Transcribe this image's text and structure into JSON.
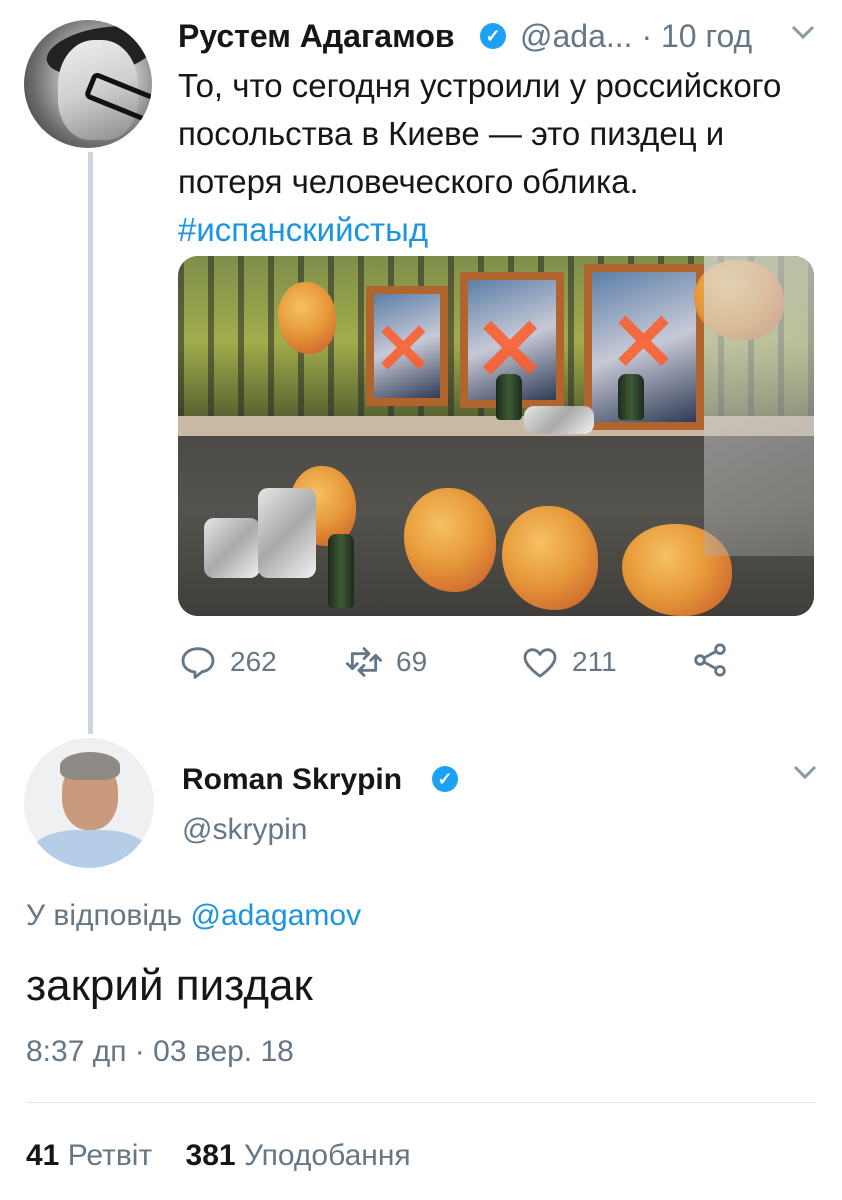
{
  "parent_tweet": {
    "author_name": "Рустем Адагамов",
    "handle_and_time": "@ada... · 10 год",
    "text": "То, что сегодня устроили у российского посольства в Киеве — это пиздец и потеря человеческого облика.",
    "hashtag": "#испанскийстыд",
    "reply_count": "262",
    "retweet_count": "69",
    "like_count": "211"
  },
  "reply_tweet": {
    "author_name": "Roman Skrypin",
    "handle": "@skrypin",
    "replying_prefix": "У відповідь",
    "replying_to": "@adagamov",
    "text": "закрий пиздак",
    "timestamp": "8:37 дп · 03 вер. 18",
    "retweets_count": "41",
    "retweets_label": "Ретвіт",
    "likes_count": "381",
    "likes_label": "Уподобання"
  },
  "icons": {
    "verified": "verified-badge-icon",
    "more": "chevron-down-icon",
    "reply": "reply-icon",
    "retweet": "retweet-icon",
    "like": "heart-icon",
    "share": "share-icon"
  },
  "colors": {
    "accent": "#1b95e0",
    "verified": "#1da1f2",
    "secondary_text": "#657786",
    "thread_line": "#cdd6dd"
  }
}
